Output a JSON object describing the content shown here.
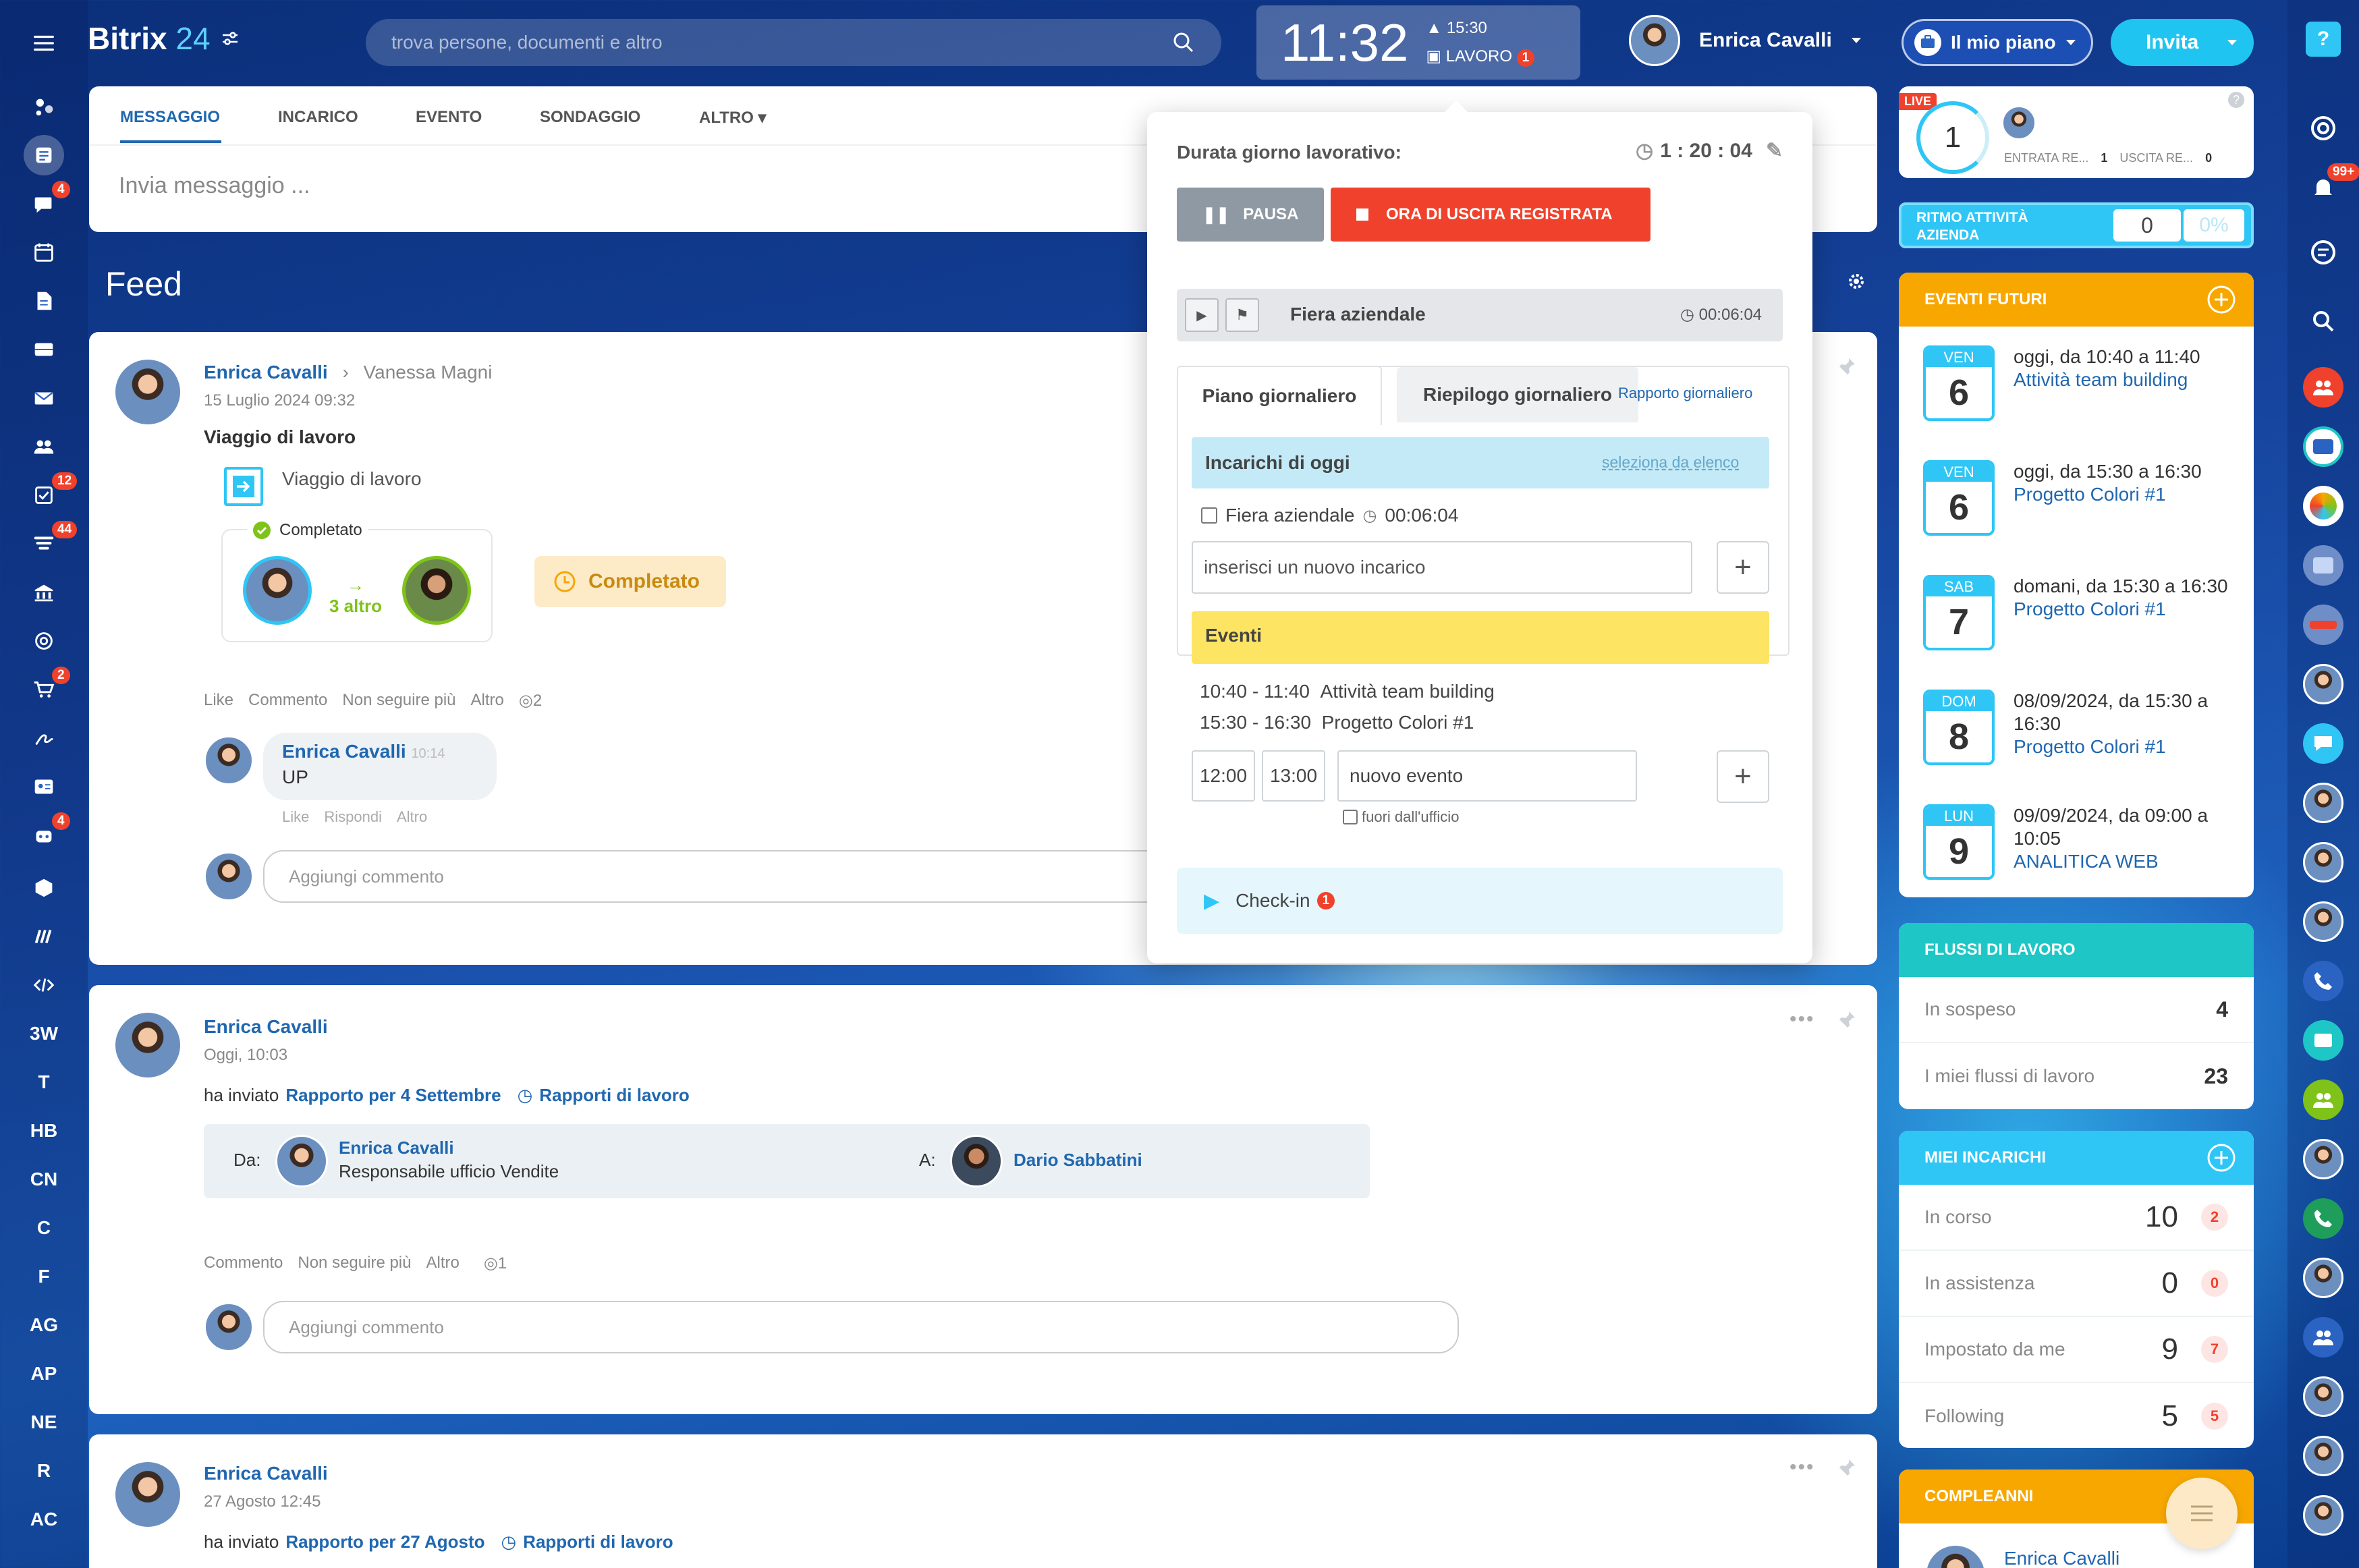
{
  "app": {
    "name": "Bitrix",
    "version": "24"
  },
  "search": {
    "placeholder": "trova persone, documenti e altro"
  },
  "clock": {
    "time": "11:32",
    "alarm": "15:30",
    "status": "LAVORO",
    "status_count": "1"
  },
  "user": {
    "name": "Enrica Cavalli"
  },
  "header": {
    "plan_label": "Il mio piano",
    "invite_label": "Invita"
  },
  "left_nav": {
    "badges": {
      "chat": "4",
      "tasks": "12",
      "crm": "44",
      "shop": "2",
      "robots": "4"
    },
    "text_items": [
      "3W",
      "T",
      "HB",
      "CN",
      "C",
      "F",
      "AG",
      "AP",
      "NE",
      "R",
      "AC"
    ]
  },
  "composer": {
    "tabs": [
      "MESSAGGIO",
      "INCARICO",
      "EVENTO",
      "SONDAGGIO",
      "ALTRO"
    ],
    "placeholder": "Invia messaggio ..."
  },
  "feed": {
    "title": "Feed"
  },
  "post1": {
    "author": "Enrica Cavalli",
    "recipient": "Vanessa Magni",
    "date": "15 Luglio 2024 09:32",
    "title": "Viaggio di lavoro",
    "workflow": "Viaggio di lavoro",
    "status_label": "Completato",
    "more": "3 altro",
    "completed_button": "Completato",
    "actions": [
      "Like",
      "Commento",
      "Non seguire più",
      "Altro"
    ],
    "views": "2",
    "comment": {
      "author": "Enrica Cavalli",
      "time": "10:14",
      "text": "UP",
      "actions": [
        "Like",
        "Rispondi",
        "Altro"
      ]
    },
    "add_comment": "Aggiungi commento"
  },
  "post2": {
    "author": "Enrica Cavalli",
    "date": "Oggi, 10:03",
    "sent": "ha inviato",
    "report": "Rapporto per 4 Settembre",
    "category": "Rapporti di lavoro",
    "from_label": "Da:",
    "from_name": "Enrica Cavalli",
    "from_role": "Responsabile ufficio Vendite",
    "to_label": "A:",
    "to_name": "Dario Sabbatini",
    "actions": [
      "Commento",
      "Non seguire più",
      "Altro"
    ],
    "views": "1",
    "add_comment": "Aggiungi commento"
  },
  "post3": {
    "author": "Enrica Cavalli",
    "date": "27 Agosto 12:45",
    "sent": "ha inviato",
    "report": "Rapporto per 27 Agosto",
    "category": "Rapporti di lavoro"
  },
  "workday": {
    "label": "Durata giorno lavorativo:",
    "duration": "1 : 20 : 04",
    "pause": "PAUSA",
    "stop": "ORA DI USCITA REGISTRATA",
    "current_task": "Fiera aziendale",
    "current_time": "00:06:04",
    "tab_plan": "Piano giornaliero",
    "tab_summary": "Riepilogo giornaliero",
    "report_link": "Rapporto giornaliero",
    "tasks_header": "Incarichi di oggi",
    "select_link": "seleziona da elenco",
    "task_item": "Fiera aziendale",
    "task_item_time": "00:06:04",
    "new_task_placeholder": "inserisci un nuovo incarico",
    "events_header": "Eventi",
    "events": [
      {
        "time": "10:40 - 11:40",
        "title": "Attività team building"
      },
      {
        "time": "15:30 - 16:30",
        "title": "Progetto Colori #1"
      }
    ],
    "new_event": {
      "from": "12:00",
      "to": "13:00",
      "placeholder": "nuovo evento",
      "out_office": "fuori dall'ufficio"
    },
    "checkin": "Check-in",
    "checkin_count": "1"
  },
  "timeman": {
    "live": "LIVE",
    "value": "1",
    "in_label": "ENTRATA RE...",
    "in_value": "1",
    "out_label": "USCITA RE...",
    "out_value": "0"
  },
  "pulse": {
    "label": "RITMO ATTIVITÀ AZIENDA",
    "value": "0",
    "percent": "0%"
  },
  "events_widget": {
    "title": "EVENTI FUTURI",
    "items": [
      {
        "day": "VEN",
        "num": "6",
        "when": "oggi, da 10:40 a 11:40",
        "title": "Attività team building"
      },
      {
        "day": "VEN",
        "num": "6",
        "when": "oggi, da 15:30 a 16:30",
        "title": "Progetto Colori #1"
      },
      {
        "day": "SAB",
        "num": "7",
        "when": "domani, da 15:30 a 16:30",
        "title": "Progetto Colori #1"
      },
      {
        "day": "DOM",
        "num": "8",
        "when": "08/09/2024, da 15:30 a 16:30",
        "title": "Progetto Colori #1"
      },
      {
        "day": "LUN",
        "num": "9",
        "when": "09/09/2024, da 09:00 a 10:05",
        "title": "ANALITICA WEB"
      }
    ]
  },
  "workflows": {
    "title": "FLUSSI DI LAVORO",
    "rows": [
      {
        "label": "In sospeso",
        "value": "4"
      },
      {
        "label": "I miei flussi di lavoro",
        "value": "23"
      }
    ]
  },
  "my_tasks": {
    "title": "MIEI INCARICHI",
    "rows": [
      {
        "label": "In corso",
        "value": "10",
        "badge": "2"
      },
      {
        "label": "In assistenza",
        "value": "0",
        "badge": "0"
      },
      {
        "label": "Impostato da me",
        "value": "9",
        "badge": "7"
      },
      {
        "label": "Following",
        "value": "5",
        "badge": "5"
      }
    ]
  },
  "birthdays": {
    "title": "COMPLEANNI",
    "name": "Enrica Cavalli"
  },
  "right_bar": {
    "notifications": "99+"
  },
  "colors": {
    "accent": "#2fc6f6",
    "orange": "#f7a700",
    "teal": "#1ec6c6",
    "red": "#f0412c",
    "link": "#2067b0"
  }
}
